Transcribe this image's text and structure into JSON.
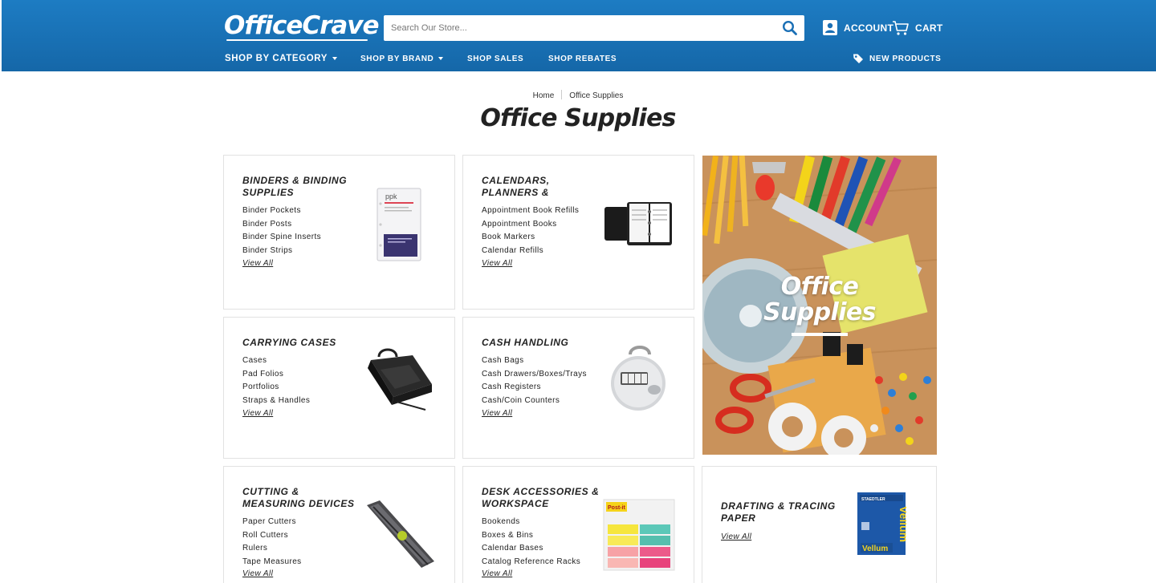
{
  "header": {
    "logo": "OfficeCrave",
    "search_placeholder": "Search Our Store...",
    "account_label": "ACCOUNT",
    "cart_label": "CART",
    "nav": {
      "shop_by_category": "SHOP BY CATEGORY",
      "shop_by_brand": "SHOP BY BRAND",
      "shop_sales": "SHOP SALES",
      "shop_rebates": "SHOP REBATES",
      "new_products": "NEW PRODUCTS"
    },
    "colors": {
      "brand_blue": "#1a6fb5",
      "white": "#ffffff"
    }
  },
  "breadcrumb": {
    "home": "Home",
    "current": "Office Supplies"
  },
  "page_title": "Office Supplies",
  "promo": {
    "line1": "Office",
    "line2": "Supplies"
  },
  "categories": [
    {
      "title": "BINDERS & BINDING SUPPLIES",
      "links": [
        "Binder Pockets",
        "Binder Posts",
        "Binder Spine Inserts",
        "Binder Strips"
      ],
      "view_all": "View All",
      "icon": "binder-pocket-image"
    },
    {
      "title": "CALENDARS, PLANNERS &",
      "links": [
        "Appointment Book Refills",
        "Appointment Books",
        "Book Markers",
        "Calendar Refills"
      ],
      "view_all": "View All",
      "icon": "planner-image"
    },
    {
      "title": "CARRYING CASES",
      "links": [
        "Cases",
        "Pad Folios",
        "Portfolios",
        "Straps & Handles"
      ],
      "view_all": "View All",
      "icon": "carrying-case-image"
    },
    {
      "title": "CASH HANDLING",
      "links": [
        "Cash Bags",
        "Cash Drawers/Boxes/Trays",
        "Cash Registers",
        "Cash/Coin Counters"
      ],
      "view_all": "View All",
      "icon": "tally-counter-image"
    },
    {
      "title": "CUTTING & MEASURING DEVICES",
      "links": [
        "Paper Cutters",
        "Roll Cutters",
        "Rulers",
        "Tape Measures"
      ],
      "view_all": "View All",
      "icon": "paper-cutter-image"
    },
    {
      "title": "DESK ACCESSORIES & WORKSPACE",
      "links": [
        "Bookends",
        "Boxes & Bins",
        "Calendar Bases",
        "Catalog Reference Racks"
      ],
      "view_all": "View All",
      "icon": "sticky-flags-image"
    },
    {
      "title": "DRAFTING & TRACING PAPER",
      "links": [],
      "view_all": "View All",
      "icon": "vellum-pad-image"
    }
  ],
  "product_labels": {
    "ppk": "ppk",
    "postit": "Post-it",
    "staedtler": "STAEDTLER",
    "vellum": "Vellum"
  }
}
